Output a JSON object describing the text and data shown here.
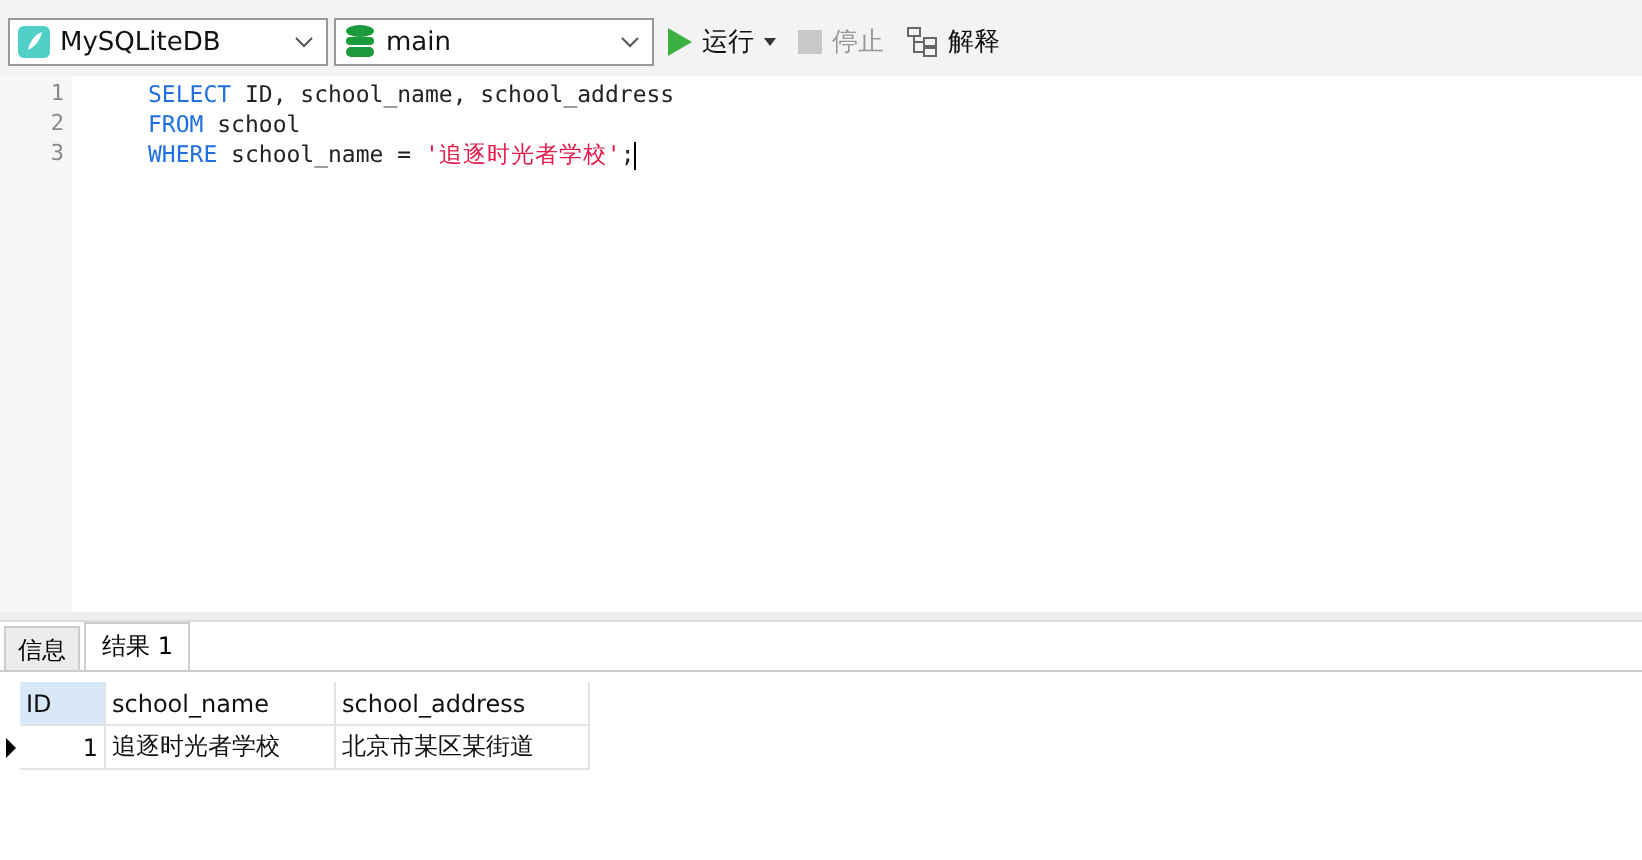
{
  "toolbar": {
    "connection": "MySQLiteDB",
    "database": "main",
    "buttons": [
      {
        "kind": "run",
        "label": "运行",
        "disabled": false,
        "dropdown": true
      },
      {
        "kind": "stop",
        "label": "停止",
        "disabled": true,
        "dropdown": false
      },
      {
        "kind": "explain",
        "label": "解释",
        "disabled": false,
        "dropdown": false
      }
    ]
  },
  "editor": {
    "lines": [
      {
        "number": "1",
        "tokens": [
          {
            "kind": "keyword",
            "text": "SELECT"
          },
          {
            "kind": "plain",
            "text": " ID, school_name, school_address"
          }
        ]
      },
      {
        "number": "2",
        "tokens": [
          {
            "kind": "keyword",
            "text": "FROM"
          },
          {
            "kind": "plain",
            "text": " school"
          }
        ]
      },
      {
        "number": "3",
        "tokens": [
          {
            "kind": "keyword",
            "text": "WHERE"
          },
          {
            "kind": "plain",
            "text": " school_name = "
          },
          {
            "kind": "string",
            "text": "'追逐时光者学校'"
          },
          {
            "kind": "plain",
            "text": ";"
          }
        ]
      }
    ]
  },
  "tabs": [
    {
      "label": "信息",
      "selected": false
    },
    {
      "label": "结果 1",
      "selected": true
    }
  ],
  "table": {
    "columns": [
      {
        "label": "ID",
        "selected": true
      },
      {
        "label": "school_name",
        "selected": false
      },
      {
        "label": "school_address",
        "selected": false
      }
    ],
    "rows": [
      {
        "current": true,
        "cells": [
          "1",
          "追逐时光者学校",
          "北京市某区某街道"
        ]
      }
    ]
  }
}
